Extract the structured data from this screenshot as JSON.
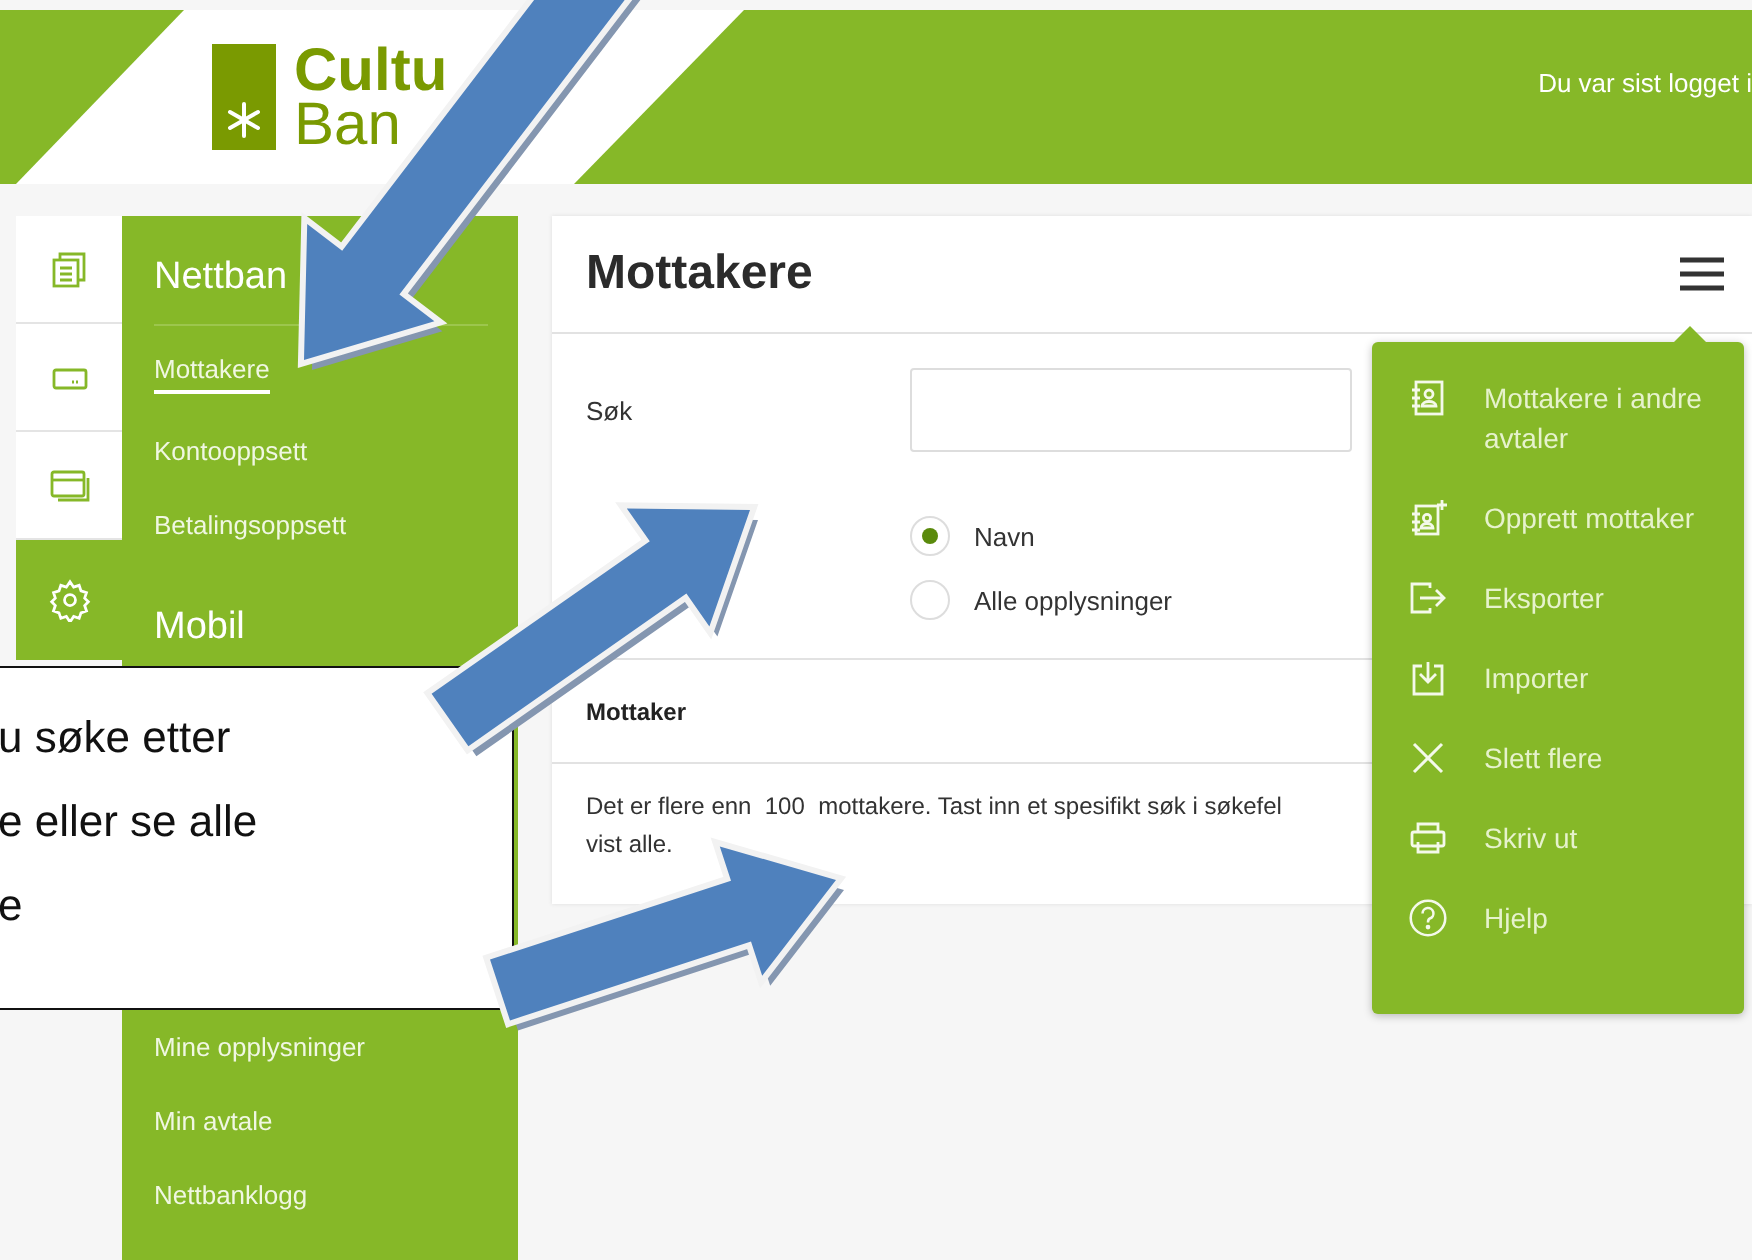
{
  "header": {
    "logo_line_1": "Cultu",
    "logo_line_2": "Ban",
    "last_login": "Du var sist logget i"
  },
  "rail": [
    {
      "kind": "documents",
      "selected": false
    },
    {
      "kind": "card-small",
      "selected": false
    },
    {
      "kind": "card",
      "selected": false
    },
    {
      "kind": "settings",
      "selected": true
    }
  ],
  "sidebar": {
    "sections": [
      {
        "title": "Nettban",
        "items": [
          {
            "label": "Mottakere",
            "selected": true
          },
          {
            "label": "Kontooppsett",
            "selected": false
          },
          {
            "label": "Betalingsoppsett",
            "selected": false
          }
        ]
      },
      {
        "title": "Mobil"
      },
      {
        "items": [
          {
            "label": "Mine opplysninger",
            "selected": false
          },
          {
            "label": "Min avtale",
            "selected": false
          },
          {
            "label": "Nettbanklogg",
            "selected": false
          }
        ]
      }
    ]
  },
  "main": {
    "title": "Mottakere",
    "search": {
      "label": "Søk"
    },
    "radios": [
      {
        "label": "Navn",
        "selected": true
      },
      {
        "label": "Alle opplysninger",
        "selected": false
      }
    ],
    "table": {
      "column": "Mottaker"
    },
    "message_lines": [
      "Det er flere enn  100  mottakere. Tast inn et spesifikt søk i søkefel",
      "vist alle."
    ]
  },
  "menu": {
    "items": [
      {
        "kind": "contacts",
        "label": "Mottakere i andre avtaler"
      },
      {
        "kind": "add-contact",
        "label": "Opprett mottaker"
      },
      {
        "kind": "export",
        "label": "Eksporter"
      },
      {
        "kind": "import",
        "label": "Importer"
      },
      {
        "kind": "delete",
        "label": "Slett flere"
      },
      {
        "kind": "print",
        "label": "Skriv ut"
      },
      {
        "kind": "help",
        "label": "Hjelp"
      }
    ]
  },
  "callout": {
    "lines": [
      "u søke etter",
      "e eller se alle",
      "e"
    ]
  }
}
